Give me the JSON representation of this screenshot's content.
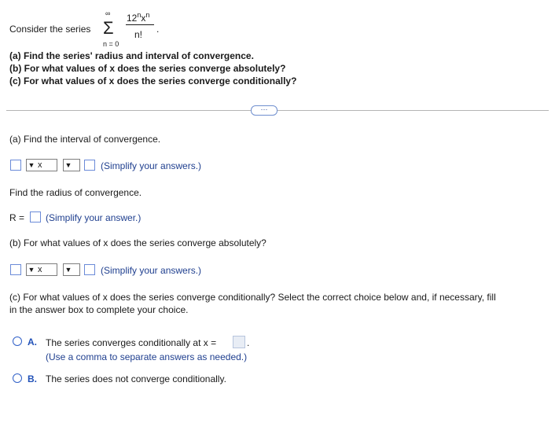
{
  "problem": {
    "intro": "Consider the series",
    "sum_upper": "∞",
    "sum_lower": "n = 0",
    "numerator_base": "12",
    "numerator_exp1": "n",
    "numerator_var": "x",
    "numerator_exp2": "n",
    "denominator": "n!",
    "period": ".",
    "part_a": "(a) Find the series' radius and interval of convergence.",
    "part_b": "(b) For what values of x does the series converge absolutely?",
    "part_c": "(c) For what values of x does the series converge conditionally?"
  },
  "more_button": "···",
  "section_a": {
    "heading": "(a) Find the interval of convergence.",
    "interval_var": "x",
    "interval_hint": "(Simplify your answers.)",
    "radius_prompt": "Find the radius of convergence.",
    "radius_label": "R =",
    "radius_hint": "(Simplify your answer.)"
  },
  "section_b": {
    "heading": "(b) For what values of x does the series converge absolutely?",
    "interval_var": "x",
    "interval_hint": "(Simplify your answers.)"
  },
  "section_c": {
    "heading_line1": "(c) For what values of x does the series converge conditionally? Select the correct choice below and, if necessary, fill",
    "heading_line2": "in the answer box to complete your choice.",
    "option_a_letter": "A.",
    "option_a_text": "The series converges conditionally at x =",
    "option_a_period": ".",
    "option_a_hint": "(Use a comma to separate answers as needed.)",
    "option_b_letter": "B.",
    "option_b_text": "The series does not converge conditionally."
  },
  "icons": {
    "dropdown": "▼"
  }
}
